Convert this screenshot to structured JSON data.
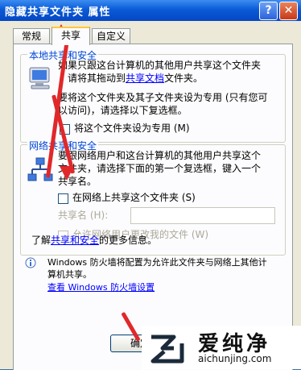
{
  "window": {
    "title": "隐藏共享文件夹 属性",
    "help_label": "?",
    "close_label": "✕"
  },
  "tabs": [
    {
      "label": "常规"
    },
    {
      "label": "共享"
    },
    {
      "label": "自定义"
    }
  ],
  "local_group": {
    "title": "本地共享和安全",
    "line1": "如果只跟这台计算机的其他用户共享这个文件夹",
    "line2a": "，请将其拖动到",
    "line2link": "共享文档",
    "line2b": "文件夹。",
    "line3": "要将这个文件夹及其子文件夹设为专用 (只有您可",
    "line4": "以访问)，请选择以下复选框。",
    "checkbox_label": "将这个文件夹设为专用 (M)"
  },
  "network_group": {
    "title": "网络共享和安全",
    "line1": "要跟网络用户和这台计算机的其他用户共享这个",
    "line2": "文件夹，请选择下面的第一个复选框，键入一个",
    "line3": "共享名。",
    "share_checkbox_label": "在网络上共享这个文件夹 (S)",
    "share_name_label": "共享名 (H):",
    "share_name_value": "",
    "allow_change_label": "允许网络用户更改我的文件 (W)"
  },
  "learn_more": {
    "prefix": "了解",
    "link": "共享和安全",
    "suffix": "的更多信息。"
  },
  "firewall": {
    "line1": "Windows 防火墙将配置为允许此文件夹与网络上其他计",
    "line2": "算机共享。",
    "link": "查看 Windows 防火墙设置"
  },
  "buttons": {
    "ok": "确定"
  },
  "watermark": {
    "name": "爱纯净",
    "url": "aichunjing.com"
  },
  "colors": {
    "title_bar": "#0a5bd8",
    "group_title": "#0046d5",
    "annotation_arrow": "#e0282a"
  }
}
